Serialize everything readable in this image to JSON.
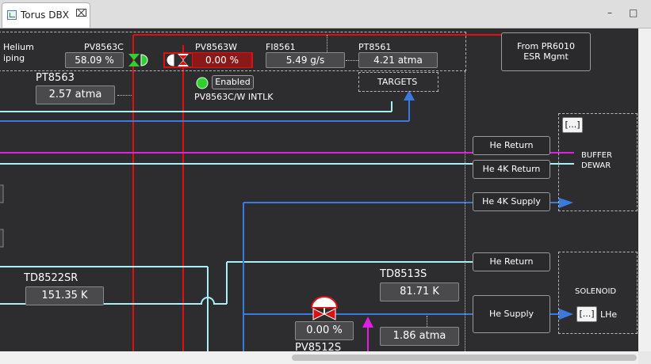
{
  "tab": {
    "title": "Torus DBX",
    "close_glyph": "⌧"
  },
  "window": {
    "minimize_glyph": "–",
    "maximize_glyph": "□"
  },
  "labels": {
    "helium_top": "Helium",
    "helium_bottom": "iping",
    "pv8563c": "PV8563C",
    "pv8563w": "PV8563W",
    "fi8561": "FI8561",
    "pt8561": "PT8561",
    "pt8563": "PT8563",
    "intlk": "PV8563C/W INTLK",
    "buffer_top": "BUFFER",
    "buffer_bottom": "DEWAR",
    "solenoid": "SOLENOID",
    "lhe": "LHe",
    "td8522sr": "TD8522SR",
    "td8513s": "TD8513S",
    "pv8512s": "PV8512S"
  },
  "values": {
    "pv8563c": "58.09 %",
    "pv8563w": "0.00 %",
    "fi8561": "5.49 g/s",
    "pt8561": "4.21 atma",
    "pt8563": "2.57 atma",
    "td8522sr": "151.35 K",
    "td8513s": "81.71 K",
    "pv8512s": "0.00 %",
    "td8513s_pressure": "1.86 atma"
  },
  "buttons": {
    "from_pr6010_line1": "From PR6010",
    "from_pr6010_line2": "ESR Mgmt",
    "targets": "TARGETS",
    "enabled": "Enabled",
    "he_return_top": "He Return",
    "he_4k_return": "He 4K Return",
    "he_4k_supply": "He 4K Supply",
    "he_return_bottom": "He Return",
    "he_supply": "He Supply",
    "ellipsis_buffer": "[...]",
    "ellipsis_solenoid": "[...]"
  },
  "colors": {
    "background": "#2d2d2f",
    "red_line": "#e01010",
    "magenta_line": "#e020e0",
    "cyan_line": "#a8f0f8",
    "blue_line": "#3a7ae0",
    "enabled_led": "#30d030"
  }
}
